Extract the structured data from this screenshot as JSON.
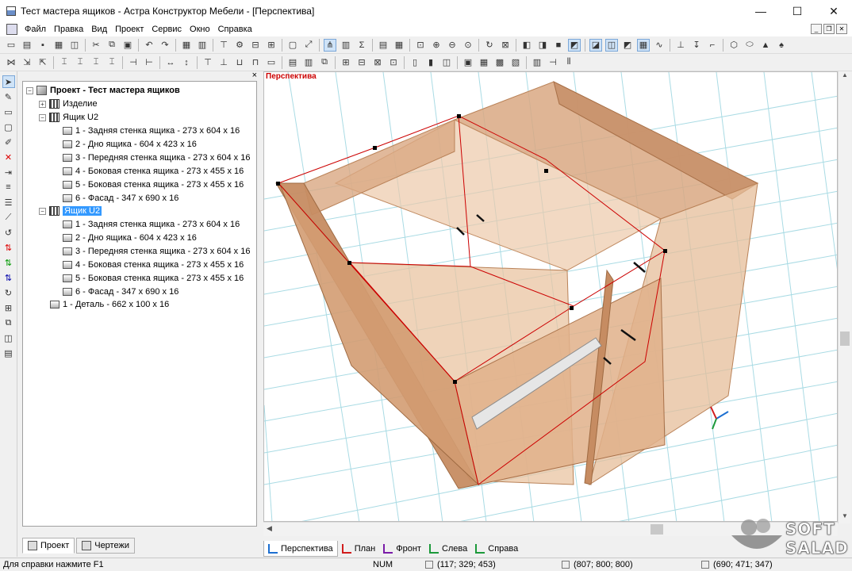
{
  "window": {
    "title": "Тест мастера ящиков - Астра Конструктор Мебели - [Перспектива]",
    "min": "—",
    "max": "☐",
    "close": "✕"
  },
  "menu": [
    "Файл",
    "Правка",
    "Вид",
    "Проект",
    "Сервис",
    "Окно",
    "Справка"
  ],
  "tree": {
    "panel_close": "×",
    "root": "Проект - Тест мастера ящиков",
    "izdelie": "Изделие",
    "box1": "Ящик U2",
    "box2": "Ящик U2",
    "box1_parts": [
      "1 - Задняя стенка ящика - 273 x 604 x 16",
      "2 - Дно ящика - 604 x 423 x 16",
      "3 - Передняя стенка ящика - 273 x 604 x 16",
      "4 - Боковая стенка ящика - 273 x 455 x 16",
      "5 - Боковая стенка ящика - 273 x 455 x 16",
      "6 - Фасад - 347 x 690 x 16"
    ],
    "box2_parts": [
      "1 - Задняя стенка ящика - 273 x 604 x 16",
      "2 - Дно ящика - 604 x 423 x 16",
      "3 - Передняя стенка ящика - 273 x 604 x 16",
      "4 - Боковая стенка ящика - 273 x 455 x 16",
      "5 - Боковая стенка ящика - 273 x 455 x 16",
      "6 - Фасад - 347 x 690 x 16"
    ],
    "detail": "1 - Деталь - 662 x 100 x 16",
    "tabs": [
      "Проект",
      "Чертежи"
    ]
  },
  "viewport": {
    "title": "Перспектива"
  },
  "view_tabs": [
    {
      "label": "Перспектива",
      "color": "#1c6fd1"
    },
    {
      "label": "План",
      "color": "#d11c1c"
    },
    {
      "label": "Фронт",
      "color": "#7a1ca8"
    },
    {
      "label": "Слева",
      "color": "#1c9a3a"
    },
    {
      "label": "Справа",
      "color": "#1c9a3a"
    }
  ],
  "status": {
    "help": "Для справки нажмите F1",
    "num": "NUM",
    "coord1": "(117; 329; 453)",
    "coord2": "(807; 800; 800)",
    "coord3": "(690; 471; 347)"
  },
  "watermark": {
    "line1": "SOFT",
    "line2": "SALAD"
  },
  "colors": {
    "wood": "#d9a882",
    "wood_dark": "#b98258",
    "highlight": "#cc0000",
    "selection": "#3399ff"
  }
}
